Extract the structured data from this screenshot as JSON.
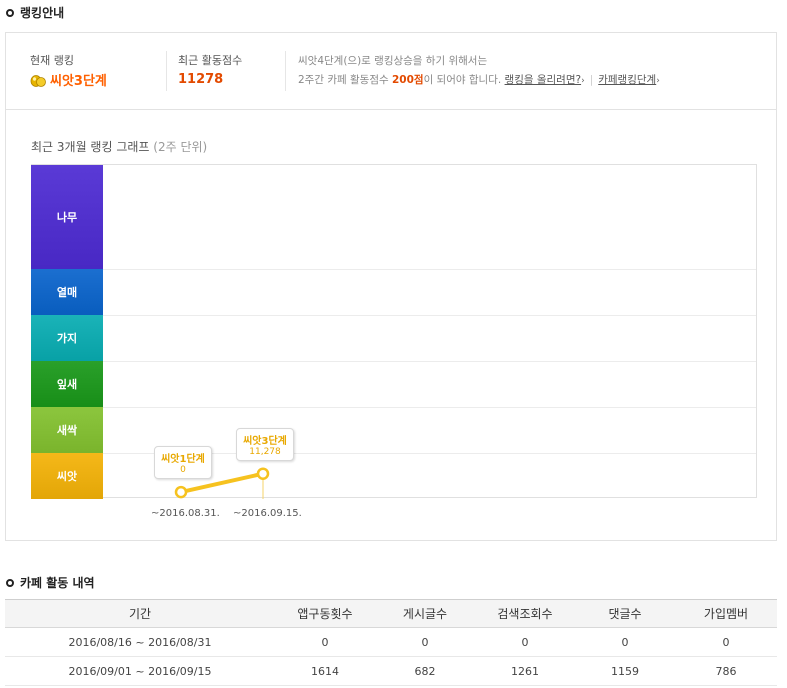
{
  "ranking_section": {
    "title": "랭킹안내",
    "current_rank_label": "현재 랭킹",
    "current_rank_value": "씨앗3단계",
    "recent_score_label": "최근 활동점수",
    "recent_score_value": "11278",
    "message_line1": "씨앗4단계(으)로 랭킹상승을 하기 위해서는",
    "message_line2_prefix": "2주간 카페 활동점수 ",
    "message_line2_points": "200점",
    "message_line2_suffix": "이 되어야 합니다.",
    "raise_rank_link": "랭킹을 올리려면?",
    "cafe_rank_link": "카페랭킹단계"
  },
  "graph": {
    "title": "최근 3개월 랭킹 그래프",
    "unit": "(2주 단위)"
  },
  "chart_data": {
    "type": "line",
    "title": "최근 3개월 랭킹 그래프",
    "subtitle": "(2주 단위)",
    "y_categories": [
      "씨앗",
      "새싹",
      "잎새",
      "가지",
      "열매",
      "나무"
    ],
    "y_category_colors": [
      "#f5b819",
      "#8cc63e",
      "#2aa02a",
      "#1ab3b8",
      "#1b6fd0",
      "#5a3ad6"
    ],
    "x": [
      "~2016.08.31.",
      "~2016.09.15."
    ],
    "series": [
      {
        "values": [
          "씨앗1단계",
          "씨앗3단계"
        ],
        "scores": [
          "0",
          "11,278"
        ],
        "color": "#f6c21f"
      }
    ],
    "grid": true
  },
  "activity_section": {
    "title": "카페 활동 내역",
    "columns": [
      "기간",
      "앱구동횟수",
      "게시글수",
      "검색조회수",
      "댓글수",
      "가입멤버"
    ],
    "rows": [
      [
        "2016/08/16 ~ 2016/08/31",
        "0",
        "0",
        "0",
        "0",
        "0"
      ],
      [
        "2016/09/01 ~ 2016/09/15",
        "1614",
        "682",
        "1261",
        "1159",
        "786"
      ]
    ]
  }
}
